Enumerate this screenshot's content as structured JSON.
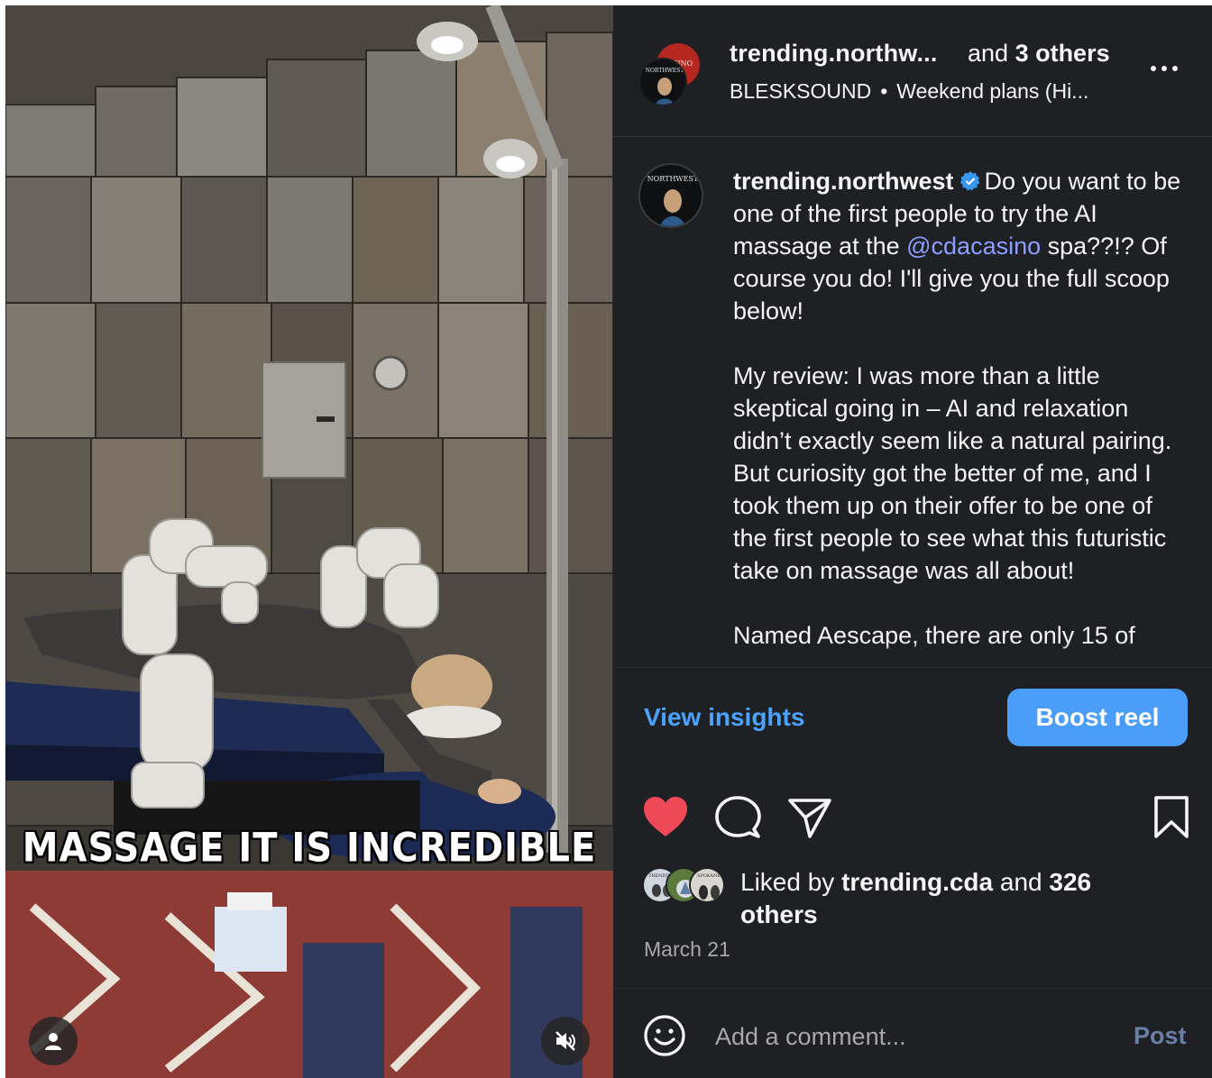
{
  "media": {
    "caption_overlay": "MASSAGE IT IS INCREDIBLE",
    "icons": {
      "user": "user-icon",
      "mute": "muted-speaker-icon"
    }
  },
  "header": {
    "username": "trending.northw...",
    "and_prefix": "and ",
    "others_count": "3 others",
    "audio_artist": "BLESKSOUND",
    "separator": "•",
    "audio_track": "Weekend plans (Hi...",
    "avatar_text": "NORTHWEST",
    "back_avatar_text": "SINO"
  },
  "post": {
    "username": "trending.northwest",
    "caption_part1": "Do you want to be one of the first people to try the AI massage at the ",
    "mention": "@cdacasino",
    "caption_part2": " spa??!? Of course you do! I'll give you the full scoop below!",
    "paragraph2": "My review: I was more than a little skeptical going in – AI and relaxation didn’t exactly seem like a natural pairing. But curiosity got the better of me, and I took them up on their offer to be one of the first people to see what this futuristic take on massage was all about!",
    "paragraph3": "Named Aescape, there are only 15 of"
  },
  "actions": {
    "view_insights": "View insights",
    "boost": "Boost reel",
    "liked": true
  },
  "likes": {
    "prefix": "Liked by ",
    "user": "trending.cda",
    "middle": " and ",
    "count": "326 others",
    "avatar_labels": [
      "TRENDING",
      "SPOKANE"
    ]
  },
  "date": "March 21",
  "comment": {
    "placeholder": "Add a comment...",
    "post_label": "Post"
  },
  "colors": {
    "panel_bg": "#1f2024",
    "link_blue": "#4aa3ff",
    "button_blue": "#4a9df8",
    "like_red": "#ed4956",
    "mention": "#8c9eff"
  }
}
